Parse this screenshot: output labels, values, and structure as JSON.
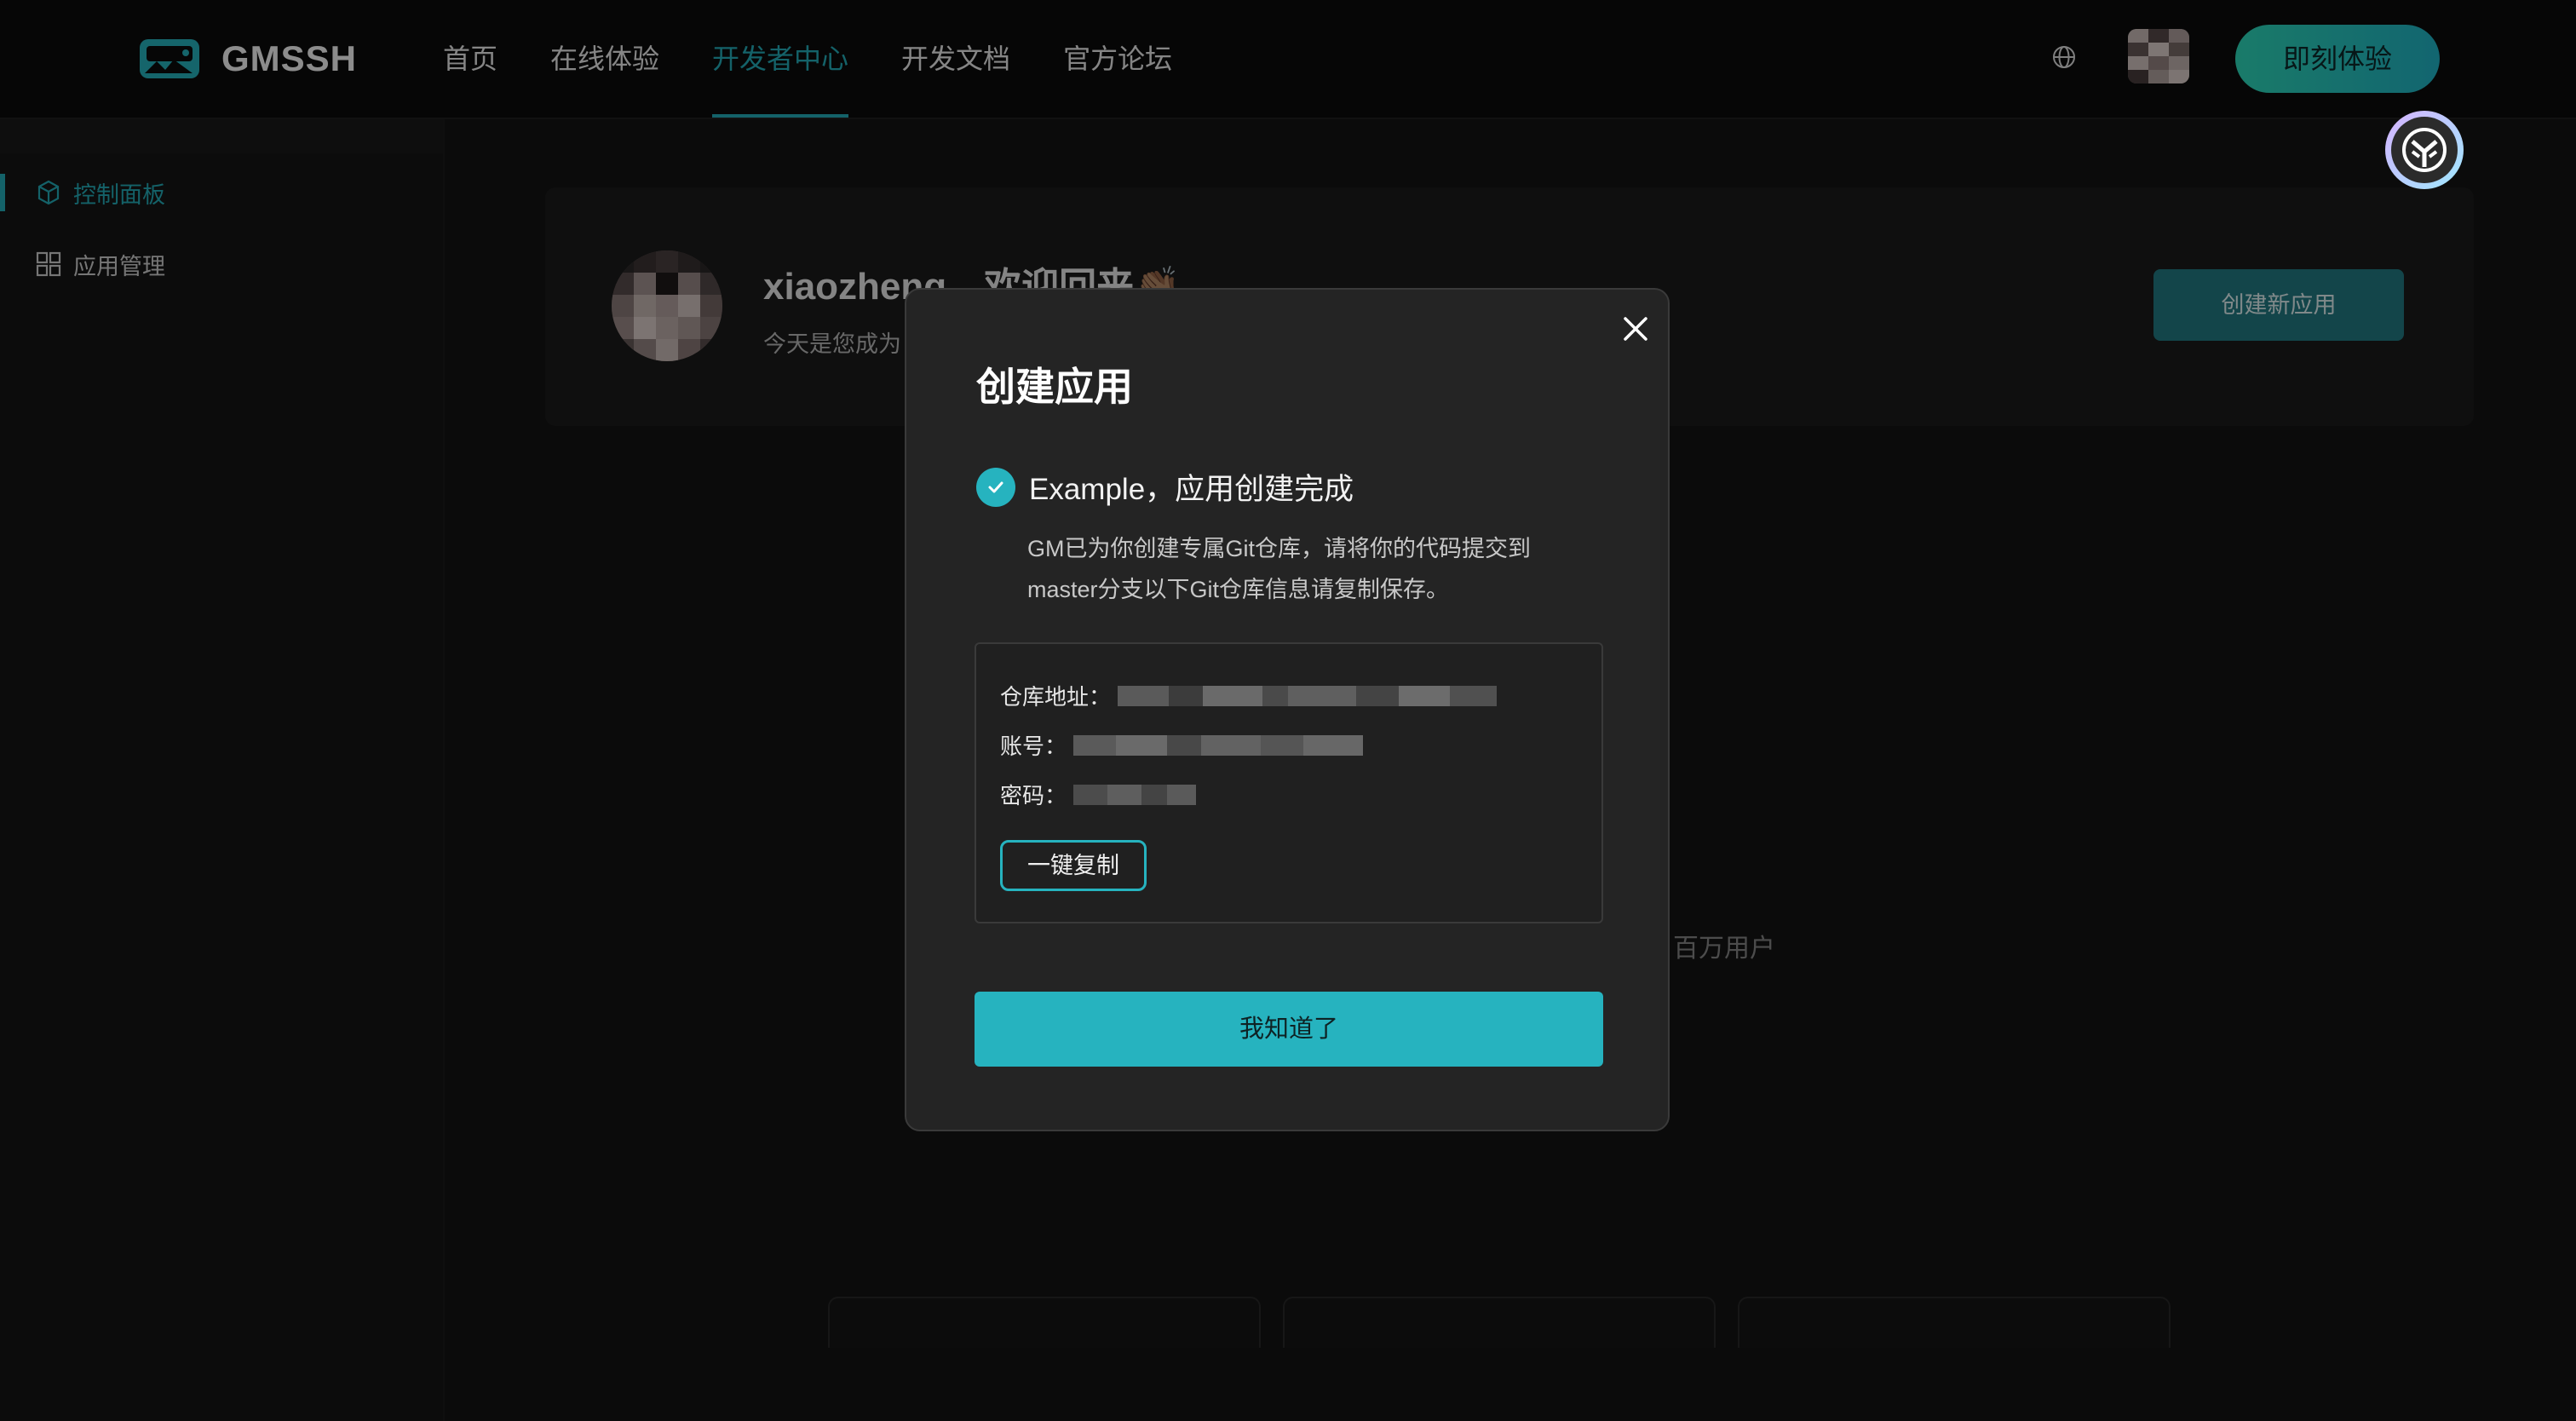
{
  "header": {
    "brand": "GMSSH",
    "nav": [
      {
        "label": "首页"
      },
      {
        "label": "在线体验"
      },
      {
        "label": "开发者中心"
      },
      {
        "label": "开发文档"
      },
      {
        "label": "官方论坛"
      }
    ],
    "active_nav": "开发者中心",
    "cta_label": "即刻体验"
  },
  "sidebar": {
    "items": [
      {
        "label": "控制面板",
        "icon": "cube-icon"
      },
      {
        "label": "应用管理",
        "icon": "grid-icon"
      }
    ],
    "active": "控制面板"
  },
  "welcome": {
    "title": "xiaozheng，欢迎回来👏🏽",
    "subtitle": "今天是您成为",
    "create_button": "创建新应用"
  },
  "background": {
    "stat_fragment": "百万用户"
  },
  "modal": {
    "title": "创建应用",
    "success_text": "Example，应用创建完成",
    "description": "GM已为你创建专属Git仓库，请将你的代码提交到master分支以下Git仓库信息请复制保存。",
    "repo_label": "仓库地址：",
    "account_label": "账号：",
    "password_label": "密码：",
    "copy_button": "一键复制",
    "confirm_button": "我知道了"
  },
  "colors": {
    "accent": "#26b3bf",
    "background": "#121212",
    "modal_bg": "#242424",
    "cta_gradient_start": "#2fe0c0",
    "cta_gradient_end": "#22b9cc"
  }
}
